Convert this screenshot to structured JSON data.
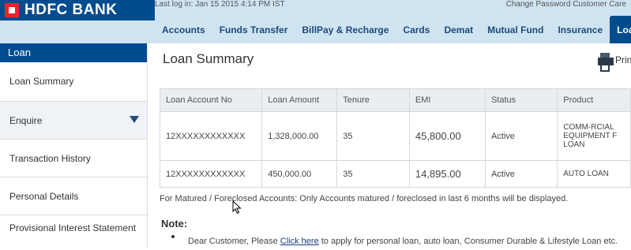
{
  "header": {
    "brand": "HDFC BANK",
    "last_login": "Last log in: Jan 15 2015 4:14 PM IST",
    "settings": "Change Password  Customer Care",
    "nav": [
      "Accounts",
      "Funds Transfer",
      "BillPay & Recharge",
      "Cards",
      "Demat",
      "Mutual Fund",
      "Insurance",
      "Loans"
    ],
    "active_nav": "Loans"
  },
  "sidebar": {
    "heading": "Loan",
    "items": [
      "Loan Summary",
      "Enquire",
      "Transaction History",
      "Personal Details",
      "Provisional Interest Statement"
    ]
  },
  "main": {
    "title": "Loan Summary",
    "print_label": "Print",
    "table": {
      "headers": [
        "Loan Account No",
        "Loan Amount",
        "Tenure",
        "EMI",
        "Status",
        "Product"
      ],
      "rows": [
        {
          "account": "12XXXXXXXXXXXX",
          "amount": "1,328,000.00",
          "tenure": "35",
          "emi": "45,800.00",
          "status": "Active",
          "product": "COMM-RCIAL EQUIPMENT F LOAN"
        },
        {
          "account": "12XXXXXXXXXXXX",
          "amount": "450,000.00",
          "tenure": "35",
          "emi": "14,895.00",
          "status": "Active",
          "product": "AUTO LOAN"
        }
      ]
    },
    "footnote": "For Matured / Foreclosed Accounts: Only Accounts matured / foreclosed in last 6 months will be displayed.",
    "note_heading": "Note:",
    "note_prefix": "Dear Customer, Please ",
    "note_link": "Click here",
    "note_suffix": " to apply for personal loan, auto loan, Consumer Durable & Lifestyle Loan etc."
  },
  "colors": {
    "brand_blue": "#004c8f",
    "brand_red": "#ed232a",
    "nav_bg": "#cfe4f1"
  }
}
